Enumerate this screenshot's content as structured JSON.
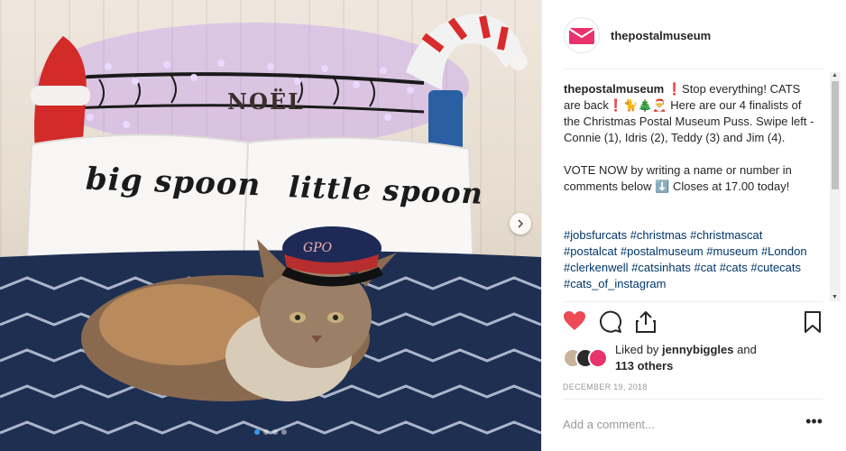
{
  "post": {
    "username": "thepostalmuseum",
    "avatar_icon": "envelope-icon",
    "photo": {
      "pillow_left": "big spoon",
      "pillow_right": "little spoon",
      "sign": "NOËL",
      "hat_monogram": "GPO",
      "carousel_count": 4,
      "carousel_active": 1
    },
    "caption": {
      "user": "thepostalmuseum",
      "line1": "❗Stop everything! CATS are back❗🐈🎄🎅 Here are our 4 finalists of the Christmas Postal Museum Puss. Swipe left - Connie (1), Idris (2), Teddy (3) and Jim (4).",
      "line2": "VOTE NOW by writing a name or number in comments below ⬇️ Closes at 17.00 today!",
      "hashtags": "#jobsfurcats #christmas #christmascat #postalcat #postalmuseum #museum #London #clerkenwell #catsinhats #cat #cats #cutecats #cats_of_instagram"
    },
    "likes": {
      "prefix": "Liked by",
      "user": "jennybiggles",
      "and": "and",
      "others": "113 others"
    },
    "date": "DECEMBER 19, 2018",
    "comment_placeholder": "Add a comment...",
    "more_label": "•••"
  },
  "colors": {
    "brand": "#e8336d",
    "like_red": "#ed4956",
    "hashtag": "#003569",
    "active_dot": "#3897f0"
  }
}
